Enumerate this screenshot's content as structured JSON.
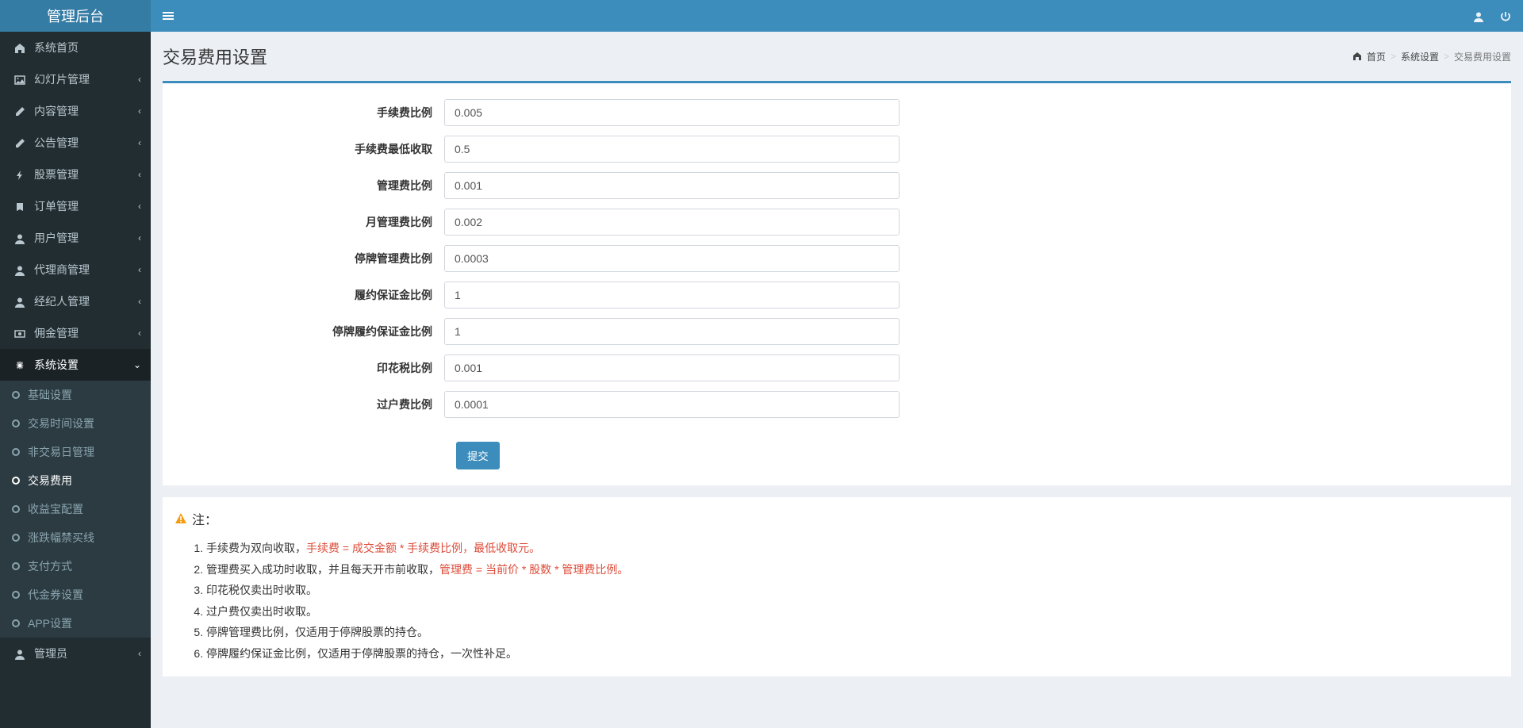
{
  "brand": "管理后台",
  "sidebar": {
    "items": [
      {
        "label": "系统首页",
        "icon": "home"
      },
      {
        "label": "幻灯片管理",
        "icon": "image",
        "chevron": "‹"
      },
      {
        "label": "内容管理",
        "icon": "edit",
        "chevron": "‹"
      },
      {
        "label": "公告管理",
        "icon": "edit",
        "chevron": "‹"
      },
      {
        "label": "股票管理",
        "icon": "bolt",
        "chevron": "‹"
      },
      {
        "label": "订单管理",
        "icon": "book",
        "chevron": "‹"
      },
      {
        "label": "用户管理",
        "icon": "user",
        "chevron": "‹"
      },
      {
        "label": "代理商管理",
        "icon": "user",
        "chevron": "‹"
      },
      {
        "label": "经纪人管理",
        "icon": "user",
        "chevron": "‹"
      },
      {
        "label": "佣金管理",
        "icon": "money",
        "chevron": "‹"
      }
    ],
    "system": {
      "label": "系统设置",
      "chevron": "⌄",
      "sub": [
        {
          "label": "基础设置"
        },
        {
          "label": "交易时间设置"
        },
        {
          "label": "非交易日管理"
        },
        {
          "label": "交易费用",
          "active": true
        },
        {
          "label": "收益宝配置"
        },
        {
          "label": "涨跌幅禁买线"
        },
        {
          "label": "支付方式"
        },
        {
          "label": "代金券设置"
        },
        {
          "label": "APP设置"
        }
      ]
    },
    "admin": {
      "label": "管理员",
      "chevron": "‹"
    }
  },
  "breadcrumb": {
    "home": "首页",
    "parent": "系统设置",
    "current": "交易费用设置"
  },
  "page_title": "交易费用设置",
  "form": {
    "fields": [
      {
        "label": "手续费比例",
        "value": "0.005"
      },
      {
        "label": "手续费最低收取",
        "value": "0.5"
      },
      {
        "label": "管理费比例",
        "value": "0.001"
      },
      {
        "label": "月管理费比例",
        "value": "0.002"
      },
      {
        "label": "停牌管理费比例",
        "value": "0.0003"
      },
      {
        "label": "履约保证金比例",
        "value": "1"
      },
      {
        "label": "停牌履约保证金比例",
        "value": "1"
      },
      {
        "label": "印花税比例",
        "value": "0.001"
      },
      {
        "label": "过户费比例",
        "value": "0.0001"
      }
    ],
    "submit": "提交"
  },
  "notes": {
    "title": "注：",
    "items": [
      {
        "pre": "手续费为双向收取，",
        "red": "手续费 = 成交金额 * 手续费比例，最低收取元。",
        "post": ""
      },
      {
        "pre": "管理费买入成功时收取，并且每天开市前收取，",
        "red": "管理费 = 当前价 * 股数 * 管理费比例。",
        "post": ""
      },
      {
        "pre": "印花税仅卖出时收取。",
        "red": "",
        "post": ""
      },
      {
        "pre": "过户费仅卖出时收取。",
        "red": "",
        "post": ""
      },
      {
        "pre": "停牌管理费比例，仅适用于停牌股票的持仓。",
        "red": "",
        "post": ""
      },
      {
        "pre": "停牌履约保证金比例，仅适用于停牌股票的持仓，一次性补足。",
        "red": "",
        "post": ""
      }
    ]
  }
}
